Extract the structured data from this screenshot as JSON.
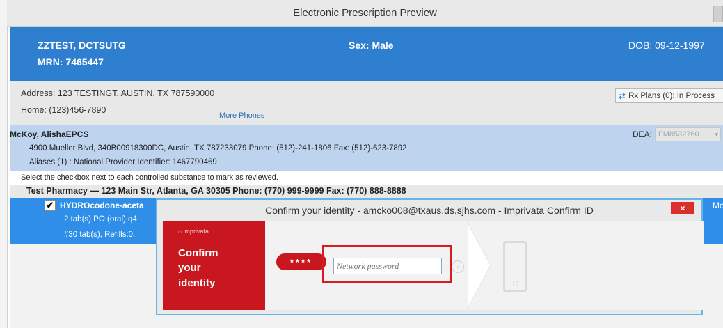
{
  "window": {
    "title": "Electronic Prescription Preview"
  },
  "patient": {
    "name": "ZZTEST, DCTSUTG",
    "mrn": "MRN: 7465447",
    "sex": "Sex: Male",
    "dob": "DOB: 09-12-1997"
  },
  "address": {
    "address_line": "Address: 123 TESTINGT, AUSTIN, TX 787590000",
    "home_phone": "Home: (123)456-7890",
    "more_phones": "More Phones",
    "rx_plans": "Rx Plans (0): In Process"
  },
  "prescriber": {
    "name": "McKoy, AlishaEPCS",
    "address": "4900 Mueller Blvd, 340B00918300DC, Austin, TX 787233079 Phone: (512)-241-1806 Fax: (512)-623-7892",
    "aliases": "Aliases (1) : National Provider Identifier: 1467790469",
    "dea_label": "DEA:",
    "dea_value": "FM8532760"
  },
  "instruction": "Select the checkbox next to each controlled substance to mark as reviewed.",
  "pharmacy": "Test Pharmacy — 123 Main Str, Atlanta, GA 30305 Phone: (770) 999-9999 Fax: (770) 888-8888",
  "medication": {
    "checked": "✔",
    "drug": "HYDROcodone-aceta",
    "sig": "2 tab(s) PO (oral) q4",
    "qty": "#30 tab(s), Refills:0,",
    "modify": "Modi"
  },
  "dialog": {
    "title": "Confirm your identity - amcko008@txaus.ds.sjhs.com - Imprivata Confirm ID",
    "close": "×",
    "brand": "imprivata",
    "confirm_line1": "Confirm",
    "confirm_line2": "your",
    "confirm_line3": "identity",
    "stars": "****",
    "password_placeholder": "Network password"
  },
  "colors": {
    "header_blue": "#2f7fd0",
    "prescriber_blue": "#bdd3ee",
    "selected_blue": "#2f8fe8",
    "imprivata_red": "#c8171e"
  }
}
